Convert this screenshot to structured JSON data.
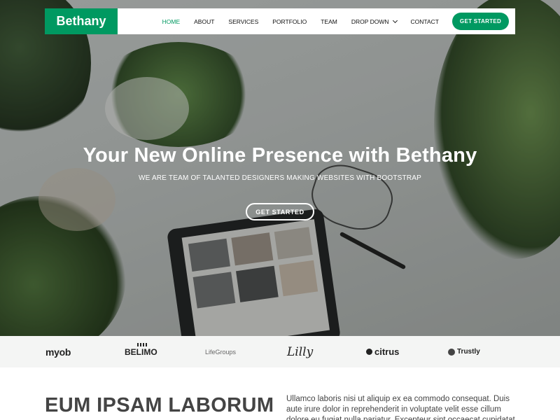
{
  "header": {
    "logo": "Bethany",
    "nav": [
      "HOME",
      "ABOUT",
      "SERVICES",
      "PORTFOLIO",
      "TEAM",
      "DROP DOWN",
      "CONTACT"
    ],
    "active_nav": "HOME",
    "cta_label": "GET STARTED"
  },
  "hero": {
    "title": "Your New Online Presence with Bethany",
    "subtitle": "WE ARE TEAM OF TALANTED DESIGNERS MAKING WEBSITES WITH BOOTSTRAP",
    "button_label": "GET STARTED"
  },
  "clients": [
    "myob",
    "BELIMO",
    "LifeGroups",
    "Lilly",
    "citrus",
    "Trustly"
  ],
  "about": {
    "title": "EUM IPSAM LABORUM",
    "text": "Ullamco laboris nisi ut aliquip ex ea commodo consequat. Duis aute irure dolor in reprehenderit in voluptate velit esse cillum dolore eu fugiat nulla pariatur. Excepteur sint occaecat cupidatat non proident"
  },
  "colors": {
    "accent": "#009961",
    "clients_bg": "#f4f5f4"
  }
}
